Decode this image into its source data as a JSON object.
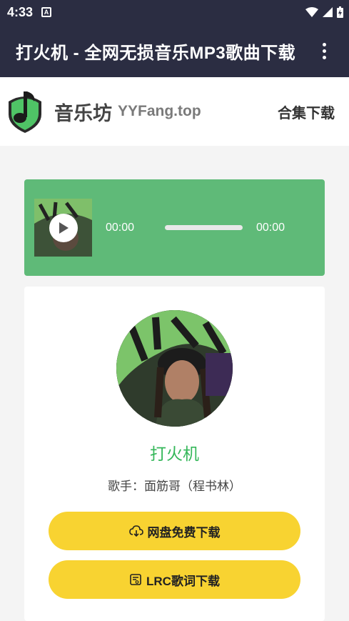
{
  "status_bar": {
    "time": "4:33"
  },
  "app_bar": {
    "title": "打火机 - 全网无损音乐MP3歌曲下载"
  },
  "header": {
    "site_name": "音乐坊",
    "site_domain": "YYFang.top",
    "collection_link": "合集下载"
  },
  "player": {
    "current_time": "00:00",
    "duration": "00:00",
    "progress": 0
  },
  "song": {
    "title": "打火机",
    "singer_label": "歌手：",
    "singer": "面筋哥（程书林）"
  },
  "buttons": {
    "cloud_download": "网盘免费下载",
    "lrc_download": "LRC歌词下载"
  },
  "colors": {
    "app_bar": "#2b2d42",
    "player_green": "#5fba78",
    "title_green": "#35b75a",
    "button_yellow": "#f8d331"
  }
}
